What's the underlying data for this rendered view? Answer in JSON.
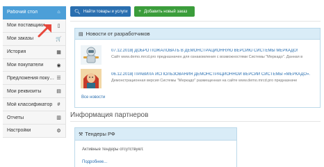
{
  "sidebar": {
    "items": [
      {
        "label": "Рабочий стол",
        "icon": "home-icon",
        "glyph": "⌂",
        "active": true
      },
      {
        "label": "Мои поставщики",
        "icon": "document-icon",
        "glyph": "▯",
        "active": false
      },
      {
        "label": "Мои заказы",
        "icon": "cart-icon",
        "glyph": "🛒",
        "active": false
      },
      {
        "label": "История",
        "icon": "calendar-icon",
        "glyph": "▦",
        "active": false
      },
      {
        "label": "Мои покупатели",
        "icon": "eye-icon",
        "glyph": "◉",
        "active": false
      },
      {
        "label": "Предложения покуп...",
        "icon": "list-icon",
        "glyph": "☰",
        "active": false
      },
      {
        "label": "Мои реквизиты",
        "icon": "id-card-icon",
        "glyph": "▤",
        "active": false
      },
      {
        "label": "Мой классификатор",
        "icon": "hash-icon",
        "glyph": "#",
        "active": false
      },
      {
        "label": "Отчеты",
        "icon": "report-icon",
        "glyph": "▥",
        "active": false
      },
      {
        "label": "Настройки",
        "icon": "gears-icon",
        "glyph": "⚙",
        "active": false
      }
    ]
  },
  "toolbar": {
    "search_label": "Найти товары и услуги",
    "add_label": "Добавить новый заказ"
  },
  "news": {
    "title": "Новости от разработчиков",
    "items": [
      {
        "title": "07.12.2018| ДОБРО ПОЖАЛОВАТЬ В ДЕМОНСТРАЦИОННУЮ ВЕРСИЮ СИСТЕМЫ МЕРКАДО!",
        "desc": "Сайт www.demo.mrcd.pro предназначен для ознакомления с возможностями Системы \"Меркадо\". Данная в"
      },
      {
        "title": "06.12.2018| ПРАВИЛА ИСПОЛЬЗОВАНИЯ ДЕМОНСТРАЦИОННОЙ ВЕРСИИ СИСТЕМЫ «МЕРКАДО».",
        "desc": "Демонстрационная версия Системы \"Меркадо\" размещенная на сайте www.demo.mrcd.pro предназначе"
      }
    ],
    "all_label": "Все новости"
  },
  "partners": {
    "title": "Информация партнеров",
    "tenders_title": "Тендеры РФ",
    "tenders_empty": "Активные тендеры отсутствуют.",
    "more_label": "Подробнее..."
  },
  "colors": {
    "active": "#4c9fd8",
    "primary": "#2a6fb0",
    "success": "#3b9d3b",
    "panel_head": "#d9ecf7",
    "pointer": "#e8473b"
  }
}
